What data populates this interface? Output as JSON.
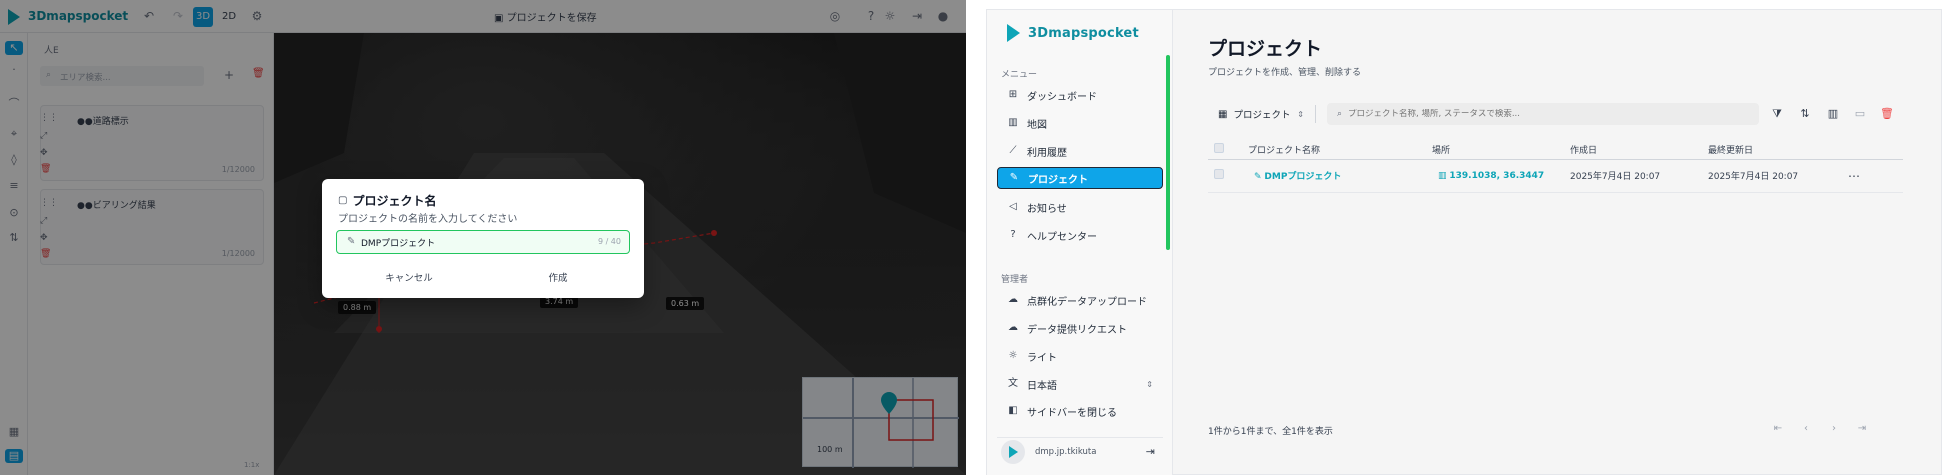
{
  "viewer": {
    "app_name": "3Dmapspocket",
    "mode_3d": "3D",
    "mode_2d": "2D",
    "save_label": "プロジェクトを保存",
    "layers_title": "人E",
    "layer_search_placeholder": "エリア検索...",
    "layers": [
      {
        "name": "●●道路標示",
        "count": "1/12000"
      },
      {
        "name": "●●ビアリング結果",
        "count": "1/12000"
      }
    ],
    "measurements": [
      "0.88 m",
      "3.74 m",
      "0.63 m"
    ],
    "minimap_scale": "100 m",
    "zoom_text": "1:1x"
  },
  "modal": {
    "title": "プロジェクト名",
    "description": "プロジェクトの名前を入力してください",
    "input_value": "DMPプロジェクト",
    "char_count": "9 / 40",
    "cancel_label": "キャンセル",
    "create_label": "作成"
  },
  "admin": {
    "brand": "3Dmapspocket",
    "menu_label": "メニュー",
    "menu": [
      {
        "label": "ダッシュボード",
        "icon": "dashboard-icon"
      },
      {
        "label": "地図",
        "icon": "map-icon"
      },
      {
        "label": "利用履歴",
        "icon": "chart-icon"
      },
      {
        "label": "プロジェクト",
        "icon": "edit-icon"
      },
      {
        "label": "お知らせ",
        "icon": "megaphone-icon"
      },
      {
        "label": "ヘルプセンター",
        "icon": "help-icon"
      }
    ],
    "admin_label": "管理者",
    "admin_menu": [
      {
        "label": "点群化データアップロード",
        "icon": "cloud-upload-icon"
      },
      {
        "label": "データ提供リクエスト",
        "icon": "cloud-request-icon"
      },
      {
        "label": "ライト",
        "icon": "sun-icon"
      },
      {
        "label": "日本語",
        "icon": "translate-icon"
      },
      {
        "label": "サイドバーを閉じる",
        "icon": "sidebar-close-icon"
      }
    ],
    "user_name": "dmp.jp.tkikuta",
    "page_title": "プロジェクト",
    "page_subtitle": "プロジェクトを作成、管理、削除する",
    "view_selector": "プロジェクト",
    "search_placeholder": "プロジェクト名称, 場所, ステータスで検索...",
    "columns": [
      "プロジェクト名称",
      "場所",
      "作成日",
      "最終更新日"
    ],
    "rows": [
      {
        "name": "DMPプロジェクト",
        "location": "139.1038, 36.3447",
        "created": "2025年7月4日 20:07",
        "updated": "2025年7月4日 20:07"
      }
    ],
    "pagination_text": "1件から1件まで、全1件を表示",
    "colors": {
      "accent": "#0ea5e9",
      "brand": "#0ea5b7",
      "success": "#22c55e",
      "danger": "#ef4444"
    }
  }
}
